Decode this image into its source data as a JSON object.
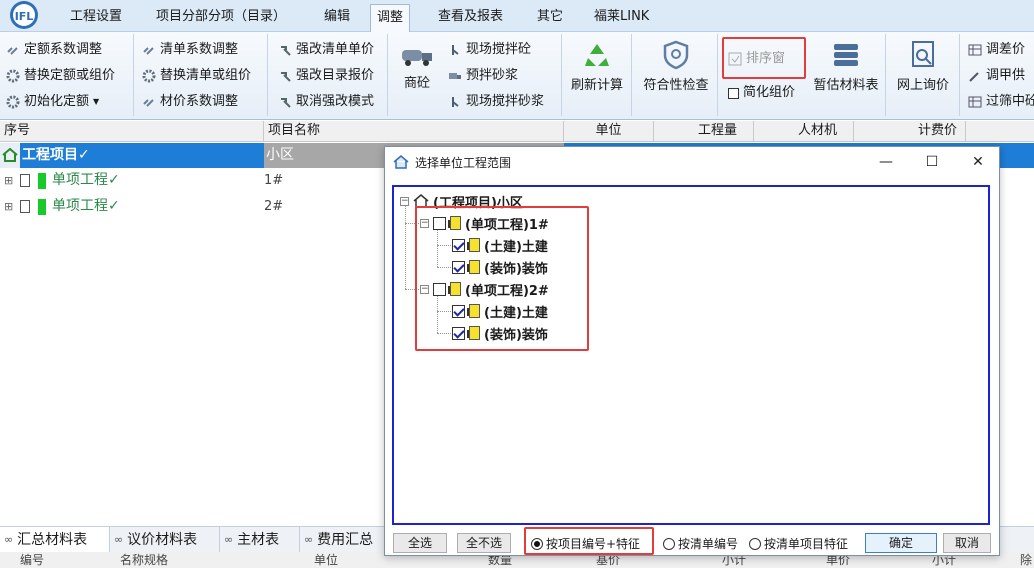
{
  "menu": {
    "logo": "IFL",
    "items": [
      "工程设置",
      "项目分部分项（目录）",
      "编辑",
      "调整",
      "查看及报表",
      "其它",
      "福莱LINK"
    ],
    "active_index": 3
  },
  "ribbon": {
    "g1": [
      "定额系数调整",
      "替换定额或组价",
      "初始化定额"
    ],
    "g2": [
      "清单系数调整",
      "替换清单或组价",
      "材价系数调整"
    ],
    "g3": [
      "强改清单单价",
      "强改目录报价",
      "取消强改模式"
    ],
    "g4_big": "商砼",
    "g4": [
      "现场搅拌砼",
      "预拌砂浆",
      "现场搅拌砂浆"
    ],
    "refresh": "刷新计算",
    "check": "符合性检查",
    "sort_window": "排序窗",
    "simplify": "简化组价",
    "estimate": "暂估材料表",
    "inquiry": "网上询价",
    "g9": [
      "调差价",
      "调甲供",
      "过筛中砼"
    ]
  },
  "grid": {
    "headers": [
      "序号",
      "项目名称",
      "单位",
      "工程量",
      "人材机",
      "计费价"
    ],
    "rows": [
      {
        "seq": "工程项目✓",
        "name": "小区",
        "selected": true
      },
      {
        "seq": "单项工程✓",
        "name": "1#",
        "selected": false
      },
      {
        "seq": "单项工程✓",
        "name": "2#",
        "selected": false
      }
    ]
  },
  "bottom": {
    "tabs": [
      "汇总材料表",
      "议价材料表",
      "主材表",
      "费用汇总"
    ],
    "headers": [
      "编号",
      "名称规格",
      "单位",
      "数量",
      "基价",
      "小计",
      "单价",
      "小计",
      "除"
    ]
  },
  "dialog": {
    "title": "选择单位工程范围",
    "root": "(工程项目)小区",
    "nodes": [
      {
        "label": "(单项工程)1#",
        "checked": false,
        "children": [
          {
            "label": "(土建)土建",
            "checked": true
          },
          {
            "label": "(装饰)装饰",
            "checked": true
          }
        ]
      },
      {
        "label": "(单项工程)2#",
        "checked": false,
        "children": [
          {
            "label": "(土建)土建",
            "checked": true
          },
          {
            "label": "(装饰)装饰",
            "checked": true
          }
        ]
      }
    ],
    "btn_all": "全选",
    "btn_none": "全不选",
    "radios": [
      "按项目编号+特征",
      "按清单编号",
      "按清单项目特征"
    ],
    "radio_selected": 0,
    "btn_ok": "确定",
    "btn_cancel": "取消"
  },
  "colors": {
    "accent": "#1e7dd6",
    "highlight_box": "#e23c3c",
    "tree_border": "#1d24c9"
  }
}
